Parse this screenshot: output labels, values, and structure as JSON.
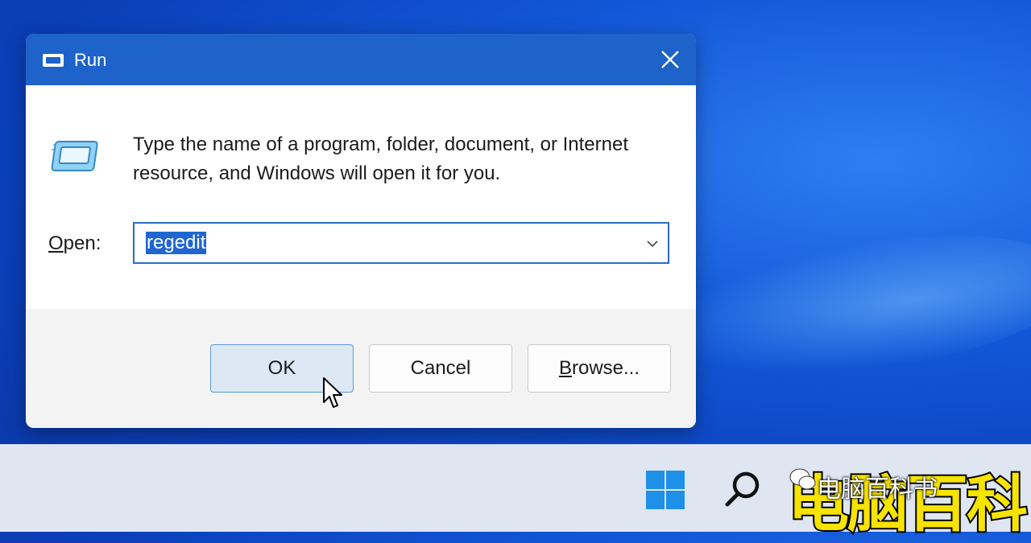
{
  "dialog": {
    "title": "Run",
    "description": "Type the name of a program, folder, document, or Internet resource, and Windows will open it for you.",
    "open_label_accel": "O",
    "open_label_rest": "pen:",
    "input_value": "regedit",
    "buttons": {
      "ok": "OK",
      "cancel": "Cancel",
      "browse_accel": "B",
      "browse_rest": "rowse..."
    }
  },
  "taskbar": {
    "icons": [
      "windows-start-icon",
      "search-icon"
    ]
  },
  "watermark": {
    "big_text": "电脑百科",
    "small_text": "电脑百科书"
  },
  "colors": {
    "titlebar": "#1d63c9",
    "selection": "#1f66d1",
    "desktop": "#1257d8",
    "watermark": "#f7e300"
  }
}
